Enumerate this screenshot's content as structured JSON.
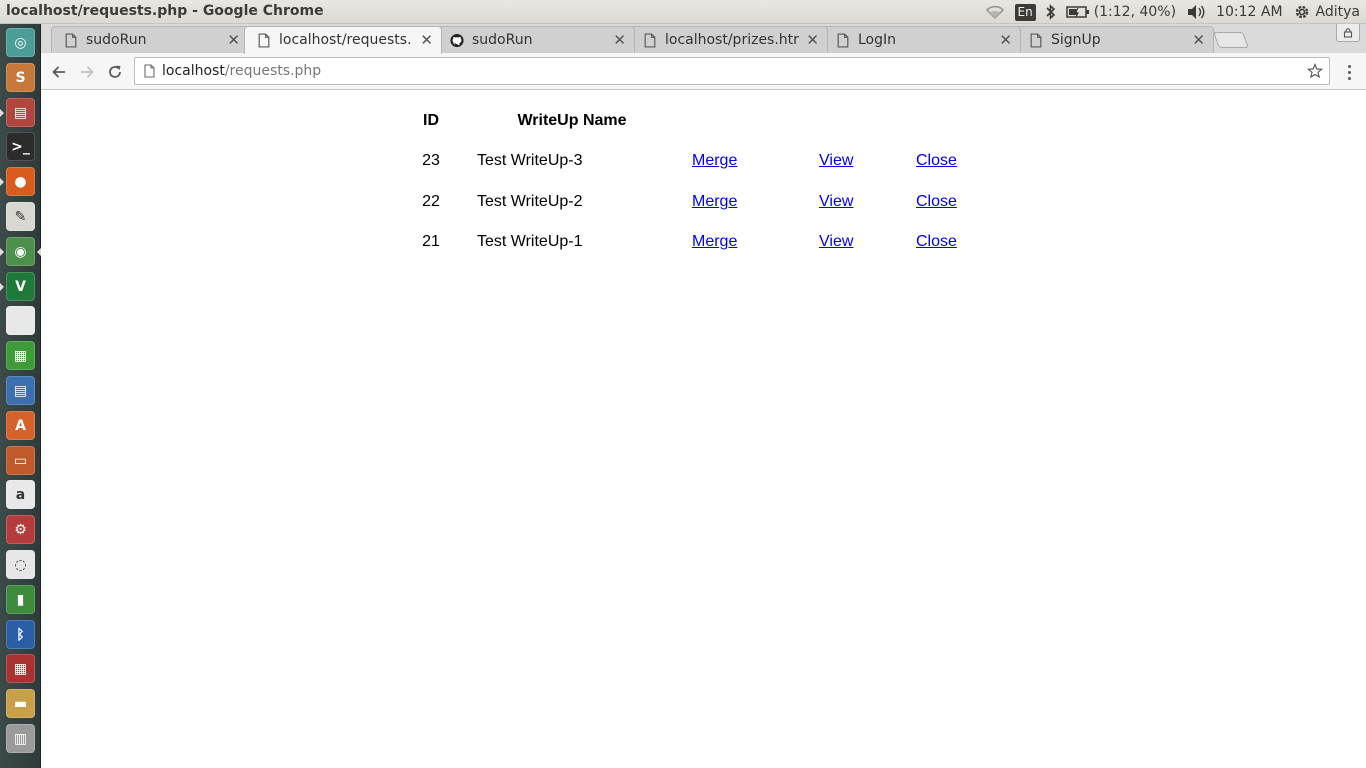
{
  "window": {
    "title": "localhost/requests.php - Google Chrome"
  },
  "top_panel": {
    "keyboard_layout": "En",
    "battery_status": "(1:12, 40%)",
    "clock": "10:12 AM",
    "user_name": "Aditya"
  },
  "tabs": [
    {
      "title": "sudoRun",
      "icon": "page-icon",
      "active": false
    },
    {
      "title": "localhost/requests.",
      "icon": "page-icon",
      "active": true
    },
    {
      "title": "sudoRun",
      "icon": "github-icon",
      "active": false
    },
    {
      "title": "localhost/prizes.htr",
      "icon": "page-icon",
      "active": false
    },
    {
      "title": "LogIn",
      "icon": "page-icon",
      "active": false
    },
    {
      "title": "SignUp",
      "icon": "page-icon",
      "active": false
    }
  ],
  "tab_close_glyph": "✕",
  "address_bar": {
    "host": "localhost",
    "path": "/requests.php"
  },
  "table": {
    "headers": {
      "id": "ID",
      "name": "WriteUp Name"
    },
    "rows": [
      {
        "id": "23",
        "name": "Test WriteUp-3",
        "merge": "Merge",
        "view": "View",
        "close": "Close"
      },
      {
        "id": "22",
        "name": "Test WriteUp-2",
        "merge": "Merge",
        "view": "View",
        "close": "Close"
      },
      {
        "id": "21",
        "name": "Test WriteUp-1",
        "merge": "Merge",
        "view": "View",
        "close": "Close"
      }
    ]
  },
  "launcher": [
    {
      "name": "ubuntu-dash-icon",
      "color": "#4b9d98",
      "glyph": "◎"
    },
    {
      "name": "sublime-text-icon",
      "color": "#c7783a",
      "glyph": "S"
    },
    {
      "name": "file-manager-icon",
      "color": "#b0463c",
      "glyph": "▤"
    },
    {
      "name": "terminal-icon",
      "color": "#2c2c2c",
      "glyph": ">_"
    },
    {
      "name": "firefox-icon",
      "color": "#d95b1d",
      "glyph": "●"
    },
    {
      "name": "text-editor-icon",
      "color": "#d8d8d0",
      "glyph": "✎"
    },
    {
      "name": "chrome-icon",
      "color": "#4e8f4b",
      "glyph": "◉"
    },
    {
      "name": "vim-icon",
      "color": "#1f7a3a",
      "glyph": "V"
    },
    {
      "name": "blank-document-icon",
      "color": "#e8e8e8",
      "glyph": ""
    },
    {
      "name": "libreoffice-calc-icon",
      "color": "#3f9a3a",
      "glyph": "▦"
    },
    {
      "name": "libreoffice-writer-icon",
      "color": "#3a6fb0",
      "glyph": "▤"
    },
    {
      "name": "software-center-icon",
      "color": "#d5622a",
      "glyph": "A"
    },
    {
      "name": "libreoffice-impress-icon",
      "color": "#c05a2a",
      "glyph": "▭"
    },
    {
      "name": "amazon-icon",
      "color": "#e8e8e8",
      "glyph": "a"
    },
    {
      "name": "system-settings-icon",
      "color": "#b43c3c",
      "glyph": "⚙"
    },
    {
      "name": "ubuntu-one-icon",
      "color": "#e6e6e6",
      "glyph": "◌"
    },
    {
      "name": "battery-tool-icon",
      "color": "#3c8c3c",
      "glyph": "▮"
    },
    {
      "name": "bluetooth-icon",
      "color": "#2a5fa8",
      "glyph": "ᛒ"
    },
    {
      "name": "workspace-switcher-icon",
      "color": "#a83232",
      "glyph": "▦"
    },
    {
      "name": "scanner-icon",
      "color": "#c9a04a",
      "glyph": "▬"
    },
    {
      "name": "trash-icon",
      "color": "#9a9a9a",
      "glyph": "▥"
    }
  ],
  "colors": {
    "link": "#0000ee",
    "launcher_bg": "#34403f",
    "tab_active": "#f6f6f6"
  }
}
